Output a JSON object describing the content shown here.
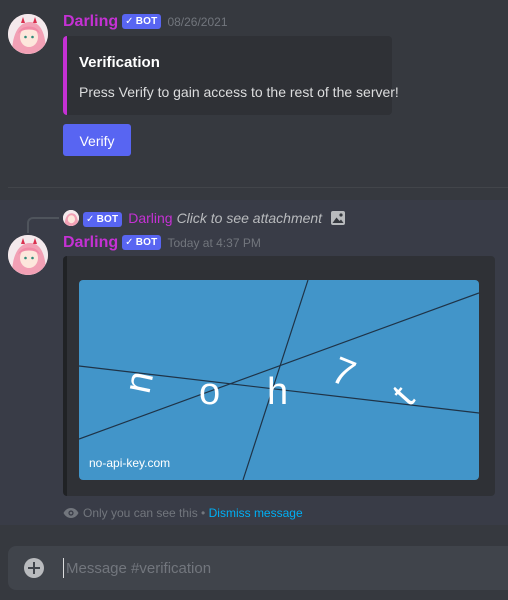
{
  "messages": [
    {
      "author": "Darling",
      "bot_tag": "BOT",
      "bot_check": "✓",
      "timestamp": "08/26/2021",
      "embed": {
        "title": "Verification",
        "description": "Press Verify to gain access to the rest of the server!",
        "accent_color": "#c531d4"
      },
      "button_label": "Verify"
    },
    {
      "reply": {
        "author": "Darling",
        "bot_tag": "BOT",
        "text": "Click to see attachment"
      },
      "author": "Darling",
      "bot_tag": "BOT",
      "bot_check": "✓",
      "timestamp": "Today at 4:37 PM",
      "captcha": {
        "characters": [
          "n",
          "o",
          "h",
          "7",
          "t"
        ],
        "watermark": "no-api-key.com",
        "background": "#4295c9"
      },
      "ephemeral_note": "Only you can see this •",
      "dismiss_label": "Dismiss message"
    }
  ],
  "composer": {
    "placeholder": "Message #verification"
  },
  "colors": {
    "background": "#36393f",
    "username": "#c531d4",
    "blurple": "#5865f2",
    "link": "#00aff4"
  }
}
